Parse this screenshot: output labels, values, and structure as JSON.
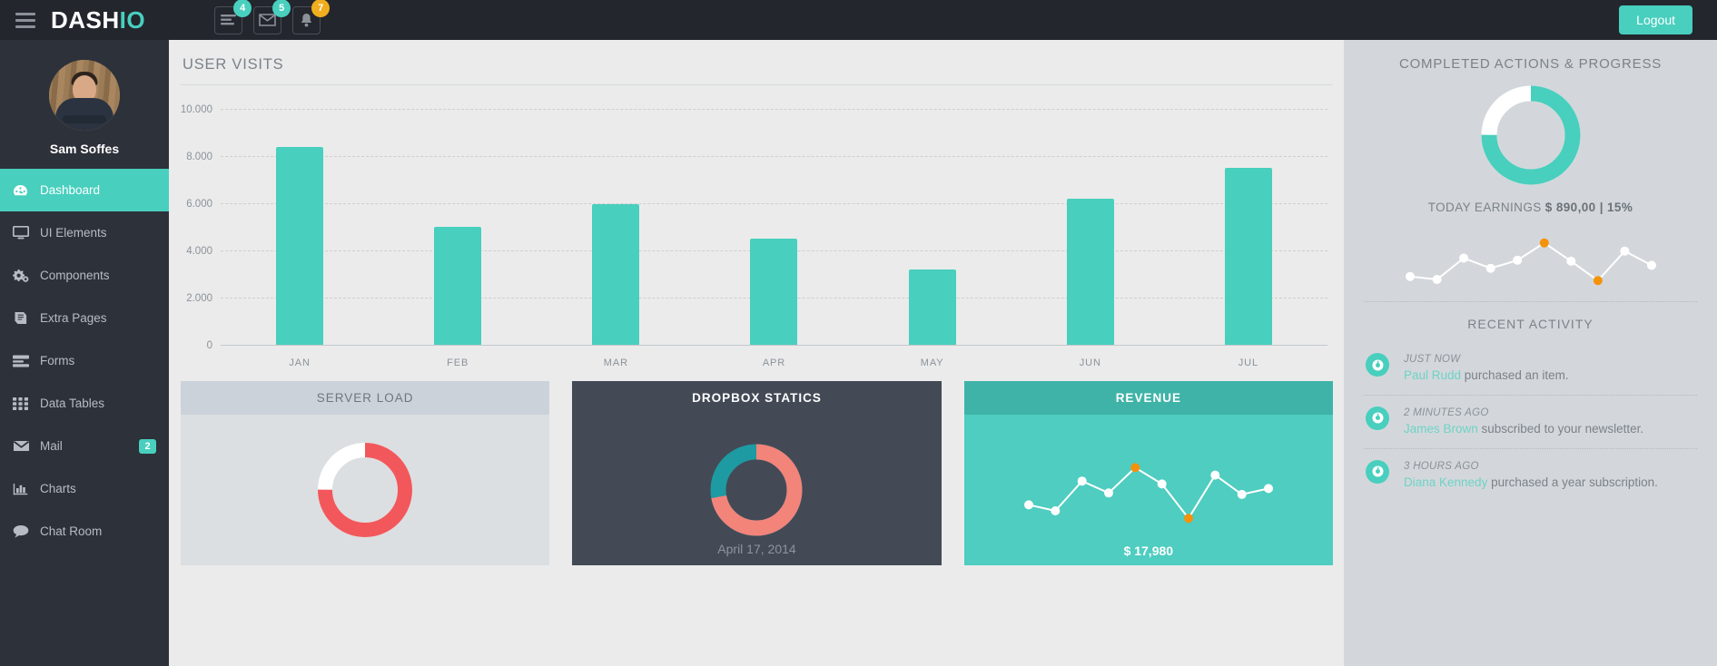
{
  "header": {
    "logo_main": "DASH",
    "logo_accent": "IO",
    "menu_icon": "hamburger-menu-icon",
    "icons": [
      {
        "name": "tasks-icon",
        "badge": "4",
        "style": "teal"
      },
      {
        "name": "envelope-icon",
        "badge": "5",
        "style": "teal"
      },
      {
        "name": "bell-icon",
        "badge": "7",
        "style": "warn"
      }
    ],
    "logout_label": "Logout"
  },
  "sidebar": {
    "user_name": "Sam Soffes",
    "items": [
      {
        "label": "Dashboard",
        "icon": "dashboard-gauge-icon",
        "active": true,
        "badge": ""
      },
      {
        "label": "UI Elements",
        "icon": "monitor-icon",
        "active": false,
        "badge": ""
      },
      {
        "label": "Components",
        "icon": "gears-icon",
        "active": false,
        "badge": ""
      },
      {
        "label": "Extra Pages",
        "icon": "book-icon",
        "active": false,
        "badge": ""
      },
      {
        "label": "Forms",
        "icon": "form-list-icon",
        "active": false,
        "badge": ""
      },
      {
        "label": "Data Tables",
        "icon": "grid-table-icon",
        "active": false,
        "badge": ""
      },
      {
        "label": "Mail",
        "icon": "envelope-icon",
        "active": false,
        "badge": "2"
      },
      {
        "label": "Charts",
        "icon": "bar-chart-icon",
        "active": false,
        "badge": ""
      },
      {
        "label": "Chat Room",
        "icon": "chat-bubble-icon",
        "active": false,
        "badge": ""
      }
    ]
  },
  "main": {
    "panel_title": "USER VISITS",
    "cards": [
      {
        "title": "SERVER LOAD",
        "kind": "donut",
        "percent": 75,
        "fg": "#f2585b",
        "bg": "#ffffff",
        "date": "",
        "value": ""
      },
      {
        "title": "DROPBOX STATICS",
        "kind": "donut2",
        "percent": 72,
        "fg": "#f2847a",
        "bg": "#1d9aa2",
        "date": "April 17, 2014",
        "value": ""
      },
      {
        "title": "REVENUE",
        "kind": "spark",
        "percent": 0,
        "fg": "#ffffff",
        "bg": "#4ecdc0",
        "date": "",
        "value": "$ 17,980"
      }
    ]
  },
  "right": {
    "progress_title": "COMPLETED ACTIONS & PROGRESS",
    "progress_percent": 75,
    "progress_color": "#48cfbe",
    "progress_track": "#ffffff",
    "earnings_prefix": "TODAY EARNINGS",
    "earnings_value": "$ 890,00 | 15%",
    "activity_title": "RECENT ACTIVITY",
    "activities": [
      {
        "icon": "clock-icon",
        "time": "JUST NOW",
        "actor": "Paul Rudd",
        "text": " purchased an item."
      },
      {
        "icon": "clock-icon",
        "time": "2 MINUTES AGO",
        "actor": "James Brown",
        "text": " subscribed to your newsletter."
      },
      {
        "icon": "clock-icon",
        "time": "3 HOURS AGO",
        "actor": "Diana Kennedy",
        "text": " purchased a year subscription."
      }
    ]
  },
  "chart_data": [
    {
      "type": "bar",
      "title": "USER VISITS",
      "categories": [
        "JAN",
        "FEB",
        "MAR",
        "APR",
        "MAY",
        "JUN",
        "JUL"
      ],
      "values": [
        8400,
        5000,
        5950,
        4500,
        3200,
        6200,
        7500
      ],
      "xlabel": "",
      "ylabel": "",
      "ylim": [
        0,
        10000
      ],
      "yticks": [
        0,
        2000,
        4000,
        6000,
        8000,
        10000
      ],
      "ytick_labels": [
        "0",
        "2.000",
        "4.000",
        "6.000",
        "8.000",
        "10.000"
      ],
      "grid": true,
      "legend": "none",
      "series_color": "#48cfbe"
    },
    {
      "type": "pie",
      "title": "SERVER LOAD",
      "labels": [
        "Load",
        "Free"
      ],
      "values": [
        75,
        25
      ],
      "colors": [
        "#f2585b",
        "#ffffff"
      ]
    },
    {
      "type": "pie",
      "title": "DROPBOX STATICS",
      "labels": [
        "Used",
        "Free"
      ],
      "values": [
        72,
        28
      ],
      "colors": [
        "#f2847a",
        "#1d9aa2"
      ],
      "annotation": "April 17, 2014"
    },
    {
      "type": "line",
      "title": "REVENUE",
      "x": [
        1,
        2,
        3,
        4,
        5,
        6,
        7,
        8,
        9,
        10
      ],
      "values": [
        30,
        22,
        62,
        46,
        80,
        58,
        12,
        70,
        44,
        52
      ],
      "ylim": [
        0,
        100
      ],
      "grid": false,
      "legend": "none",
      "series_color": "#ffffff",
      "highlight_points": [
        {
          "index": 4,
          "color": "#f5920b"
        },
        {
          "index": 6,
          "color": "#f5920b"
        }
      ],
      "annotation": "$ 17,980"
    },
    {
      "type": "pie",
      "title": "COMPLETED ACTIONS & PROGRESS",
      "labels": [
        "Completed",
        "Remaining"
      ],
      "values": [
        75,
        25
      ],
      "colors": [
        "#48cfbe",
        "#ffffff"
      ],
      "annotation": "TODAY EARNINGS $ 890,00 | 15%"
    },
    {
      "type": "line",
      "title": "Progress sparkline",
      "x": [
        1,
        2,
        3,
        4,
        5,
        6,
        7,
        8,
        9,
        10
      ],
      "values": [
        22,
        16,
        58,
        38,
        54,
        88,
        52,
        14,
        72,
        44
      ],
      "ylim": [
        0,
        100
      ],
      "grid": false,
      "legend": "none",
      "series_color": "#ffffff",
      "highlight_points": [
        {
          "index": 5,
          "color": "#f5920b"
        },
        {
          "index": 7,
          "color": "#f5920b"
        }
      ]
    }
  ]
}
